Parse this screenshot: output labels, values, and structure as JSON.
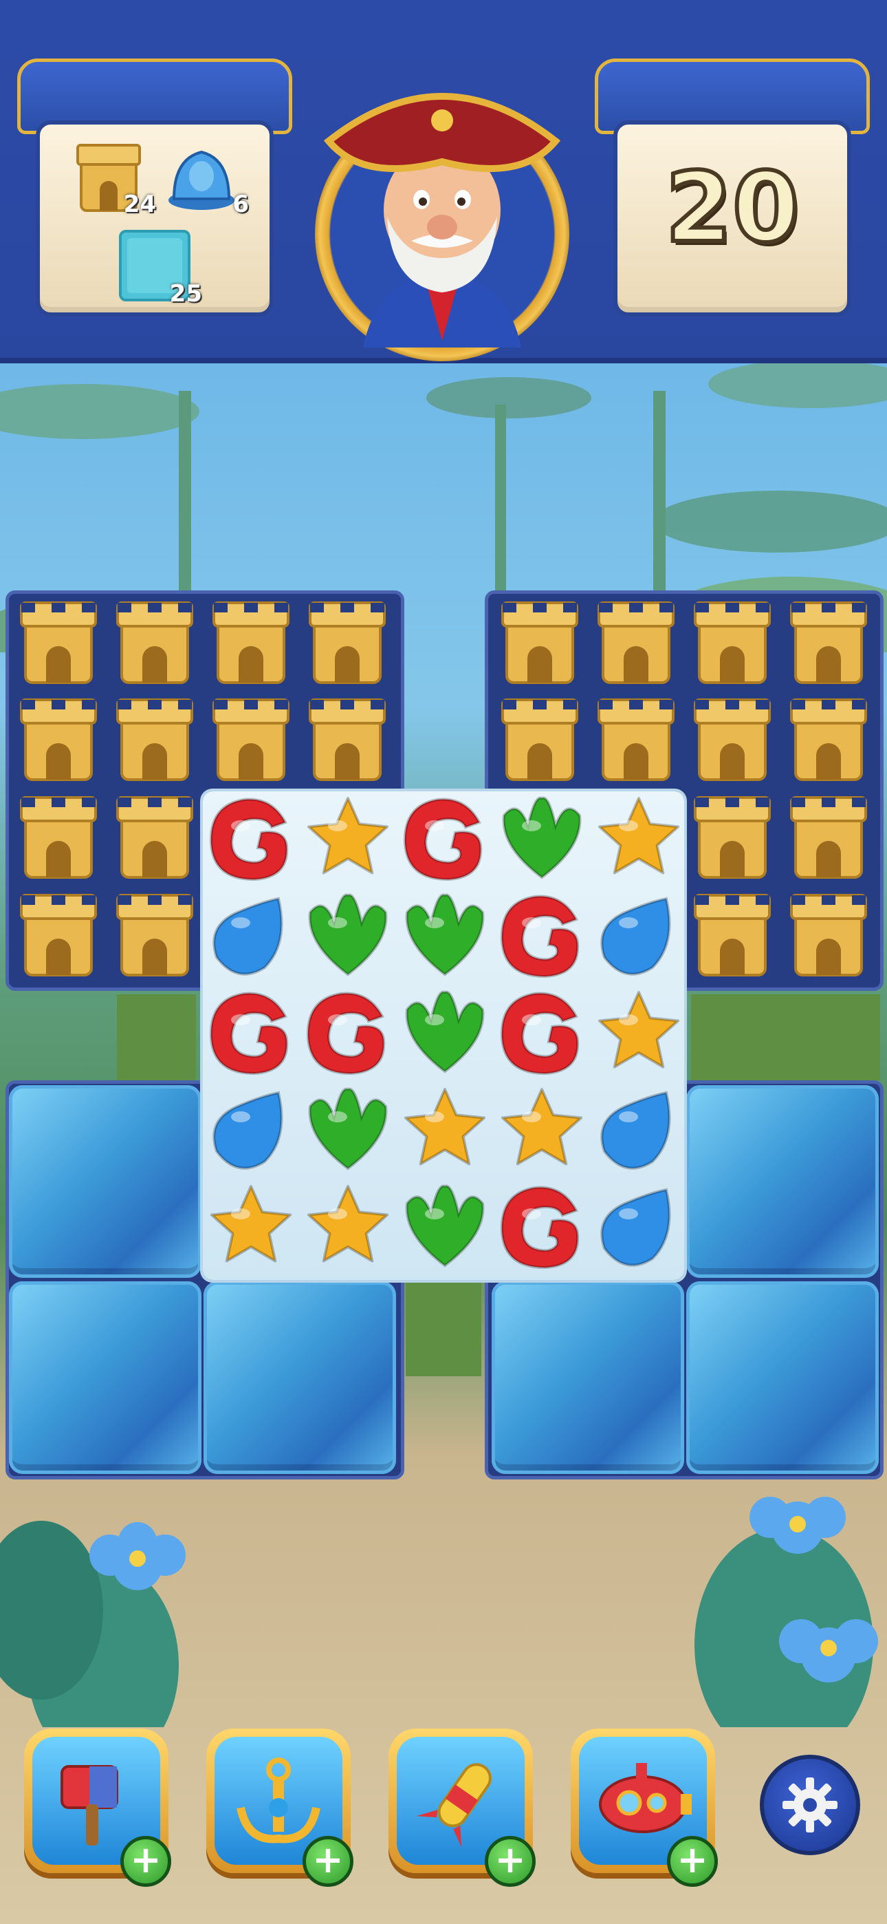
{
  "hud": {
    "goals": [
      {
        "icon": "sandcastle-icon",
        "count": "24"
      },
      {
        "icon": "blue-statue-icon",
        "count": "6"
      },
      {
        "icon": "ice-block-icon",
        "count": "25"
      }
    ],
    "moves": "20",
    "avatar": "pirate-captain-avatar"
  },
  "board": {
    "candies": [
      [
        "swirl",
        "star",
        "swirl",
        "leaf",
        "star"
      ],
      [
        "drop",
        "leaf",
        "leaf",
        "swirl",
        "drop"
      ],
      [
        "swirl",
        "swirl",
        "leaf",
        "swirl",
        "star"
      ],
      [
        "drop",
        "leaf",
        "star",
        "star",
        "drop"
      ],
      [
        "star",
        "star",
        "leaf",
        "swirl",
        "drop"
      ]
    ],
    "colors": {
      "swirl": "#e0262b",
      "star": "#f5b021",
      "leaf": "#2fae2a",
      "drop": "#2f8fe6"
    }
  },
  "boosters": [
    {
      "name": "hammer-booster",
      "icon": "hammer-icon"
    },
    {
      "name": "anchor-booster",
      "icon": "anchor-icon"
    },
    {
      "name": "rocket-booster",
      "icon": "rocket-icon"
    },
    {
      "name": "submarine-booster",
      "icon": "submarine-icon"
    }
  ],
  "plus_label": "+"
}
